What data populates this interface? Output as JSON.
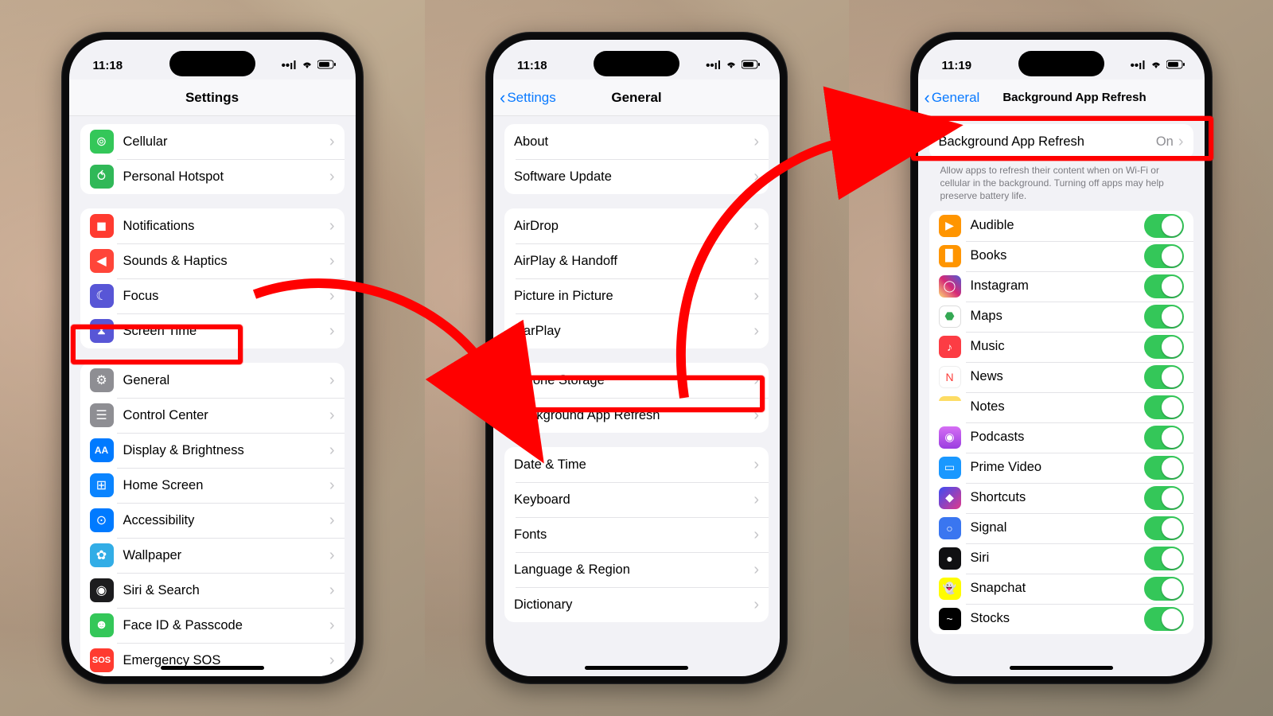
{
  "phone1": {
    "time": "11:18",
    "title": "Settings",
    "groups": [
      [
        {
          "icon": "antenna",
          "cls": "ic-green",
          "label": "Cellular"
        },
        {
          "icon": "link",
          "cls": "ic-green2",
          "label": "Personal Hotspot"
        }
      ],
      [
        {
          "icon": "bell",
          "cls": "ic-red",
          "label": "Notifications"
        },
        {
          "icon": "speaker",
          "cls": "ic-red2",
          "label": "Sounds & Haptics"
        },
        {
          "icon": "moon",
          "cls": "ic-indigo",
          "label": "Focus"
        },
        {
          "icon": "hourglass",
          "cls": "ic-indigo",
          "label": "Screen Time"
        }
      ],
      [
        {
          "icon": "gear",
          "cls": "ic-gray",
          "label": "General"
        },
        {
          "icon": "sliders",
          "cls": "ic-gray",
          "label": "Control Center"
        },
        {
          "icon": "AA",
          "cls": "ic-blue",
          "label": "Display & Brightness"
        },
        {
          "icon": "grid",
          "cls": "ic-blue2",
          "label": "Home Screen"
        },
        {
          "icon": "person",
          "cls": "ic-blue",
          "label": "Accessibility"
        },
        {
          "icon": "flower",
          "cls": "ic-cyan",
          "label": "Wallpaper"
        },
        {
          "icon": "siri",
          "cls": "ic-black",
          "label": "Siri & Search"
        },
        {
          "icon": "face",
          "cls": "ic-green",
          "label": "Face ID & Passcode"
        },
        {
          "icon": "SOS",
          "cls": "ic-sos",
          "label": "Emergency SOS"
        }
      ]
    ]
  },
  "phone2": {
    "time": "11:18",
    "title": "General",
    "back": "Settings",
    "groups": [
      [
        {
          "label": "About"
        },
        {
          "label": "Software Update"
        }
      ],
      [
        {
          "label": "AirDrop"
        },
        {
          "label": "AirPlay & Handoff"
        },
        {
          "label": "Picture in Picture"
        },
        {
          "label": "CarPlay"
        }
      ],
      [
        {
          "label": "iPhone Storage"
        },
        {
          "label": "Background App Refresh"
        }
      ],
      [
        {
          "label": "Date & Time"
        },
        {
          "label": "Keyboard"
        },
        {
          "label": "Fonts"
        },
        {
          "label": "Language & Region"
        },
        {
          "label": "Dictionary"
        }
      ]
    ]
  },
  "phone3": {
    "time": "11:19",
    "title": "Background App Refresh",
    "back": "General",
    "master": {
      "label": "Background App Refresh",
      "value": "On"
    },
    "footer": "Allow apps to refresh their content when on Wi-Fi or cellular in the background. Turning off apps may help preserve battery life.",
    "apps": [
      {
        "cls": "ic-orange",
        "label": "Audible",
        "glyph": "▶"
      },
      {
        "cls": "ic-book",
        "label": "Books",
        "glyph": "▉"
      },
      {
        "cls": "ic-insta",
        "label": "Instagram",
        "glyph": "◯"
      },
      {
        "cls": "ic-maps",
        "label": "Maps",
        "glyph": "⬣"
      },
      {
        "cls": "ic-music",
        "label": "Music",
        "glyph": "♪"
      },
      {
        "cls": "ic-news",
        "label": "News",
        "glyph": "N"
      },
      {
        "cls": "ic-notes",
        "label": "Notes",
        "glyph": ""
      },
      {
        "cls": "ic-pod",
        "label": "Podcasts",
        "glyph": "◉"
      },
      {
        "cls": "ic-prime",
        "label": "Prime Video",
        "glyph": "▭"
      },
      {
        "cls": "ic-short",
        "label": "Shortcuts",
        "glyph": "◆"
      },
      {
        "cls": "ic-signal",
        "label": "Signal",
        "glyph": "○"
      },
      {
        "cls": "ic-siri",
        "label": "Siri",
        "glyph": "●"
      },
      {
        "cls": "ic-snap",
        "label": "Snapchat",
        "glyph": "👻"
      },
      {
        "cls": "ic-stocks",
        "label": "Stocks",
        "glyph": "~"
      }
    ]
  }
}
